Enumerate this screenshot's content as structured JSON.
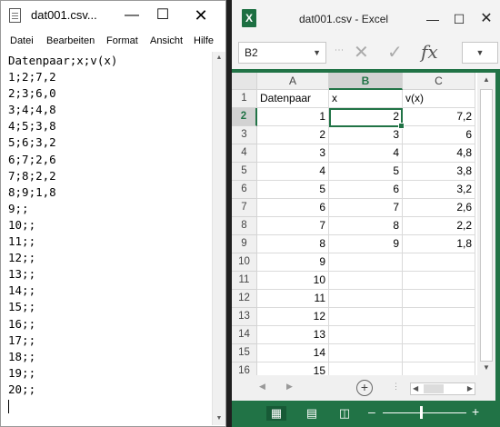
{
  "notepad": {
    "title": "dat001.csv...",
    "menu": [
      "Datei",
      "Bearbeiten",
      "Format",
      "Ansicht",
      "Hilfe"
    ],
    "lines": [
      "Datenpaar;x;v(x)",
      "1;2;7,2",
      "2;3;6,0",
      "3;4;4,8",
      "4;5;3,8",
      "5;6;3,2",
      "6;7;2,6",
      "7;8;2,2",
      "8;9;1,8",
      "9;;",
      "10;;",
      "11;;",
      "12;;",
      "13;;",
      "14;;",
      "15;;",
      "16;;",
      "17;;",
      "18;;",
      "19;;",
      "20;;"
    ]
  },
  "excel": {
    "title": "dat001.csv - Excel",
    "name_box": "B2",
    "selected_cell": "B2",
    "columns": [
      "A",
      "B",
      "C"
    ],
    "rows": [
      {
        "num": "1",
        "cells": [
          "Datenpaar",
          "x",
          "v(x)"
        ]
      },
      {
        "num": "2",
        "cells": [
          "1",
          "2",
          "7,2"
        ]
      },
      {
        "num": "3",
        "cells": [
          "2",
          "3",
          "6"
        ]
      },
      {
        "num": "4",
        "cells": [
          "3",
          "4",
          "4,8"
        ]
      },
      {
        "num": "5",
        "cells": [
          "4",
          "5",
          "3,8"
        ]
      },
      {
        "num": "6",
        "cells": [
          "5",
          "6",
          "3,2"
        ]
      },
      {
        "num": "7",
        "cells": [
          "6",
          "7",
          "2,6"
        ]
      },
      {
        "num": "8",
        "cells": [
          "7",
          "8",
          "2,2"
        ]
      },
      {
        "num": "9",
        "cells": [
          "8",
          "9",
          "1,8"
        ]
      },
      {
        "num": "10",
        "cells": [
          "9",
          "",
          ""
        ]
      },
      {
        "num": "11",
        "cells": [
          "10",
          "",
          ""
        ]
      },
      {
        "num": "12",
        "cells": [
          "11",
          "",
          ""
        ]
      },
      {
        "num": "13",
        "cells": [
          "12",
          "",
          ""
        ]
      },
      {
        "num": "14",
        "cells": [
          "13",
          "",
          ""
        ]
      },
      {
        "num": "15",
        "cells": [
          "14",
          "",
          ""
        ]
      },
      {
        "num": "16",
        "cells": [
          "15",
          "",
          ""
        ]
      }
    ],
    "colors": {
      "accent": "#217346",
      "grid_line": "#dadada",
      "header_bg": "#f0f0f0"
    }
  }
}
